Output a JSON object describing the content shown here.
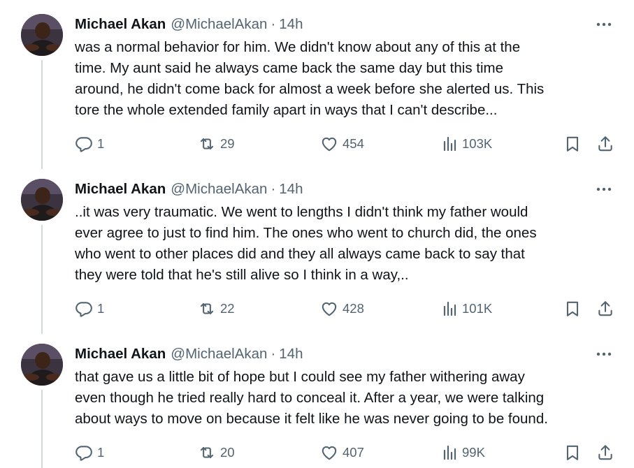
{
  "tweets": [
    {
      "author_name": "Michael Akan",
      "handle": "@MichaelAkan",
      "separator": "·",
      "time": "14h",
      "more_icon": "more-horizontal-icon",
      "text_lines": [
        "was a normal behavior for him. We didn't know about any of this at the",
        "time. My aunt said he always came back the same day but this time",
        "around, he didn't come back for almost a week before she alerted us. This",
        "tore the whole extended family apart in ways that I can't describe..."
      ],
      "replies": "1",
      "reposts": "29",
      "likes": "454",
      "views": "103K"
    },
    {
      "author_name": "Michael Akan",
      "handle": "@MichaelAkan",
      "separator": "·",
      "time": "14h",
      "more_icon": "more-horizontal-icon",
      "text_lines": [
        "..it was very traumatic. We went to lengths I didn't think my father would",
        "ever agree to just to find him. The ones who went to church did, the ones",
        "who went to other places did and they all always came back to say that",
        "they were told that he's still alive so I think in a way,.."
      ],
      "replies": "1",
      "reposts": "22",
      "likes": "428",
      "views": "101K"
    },
    {
      "author_name": "Michael Akan",
      "handle": "@MichaelAkan",
      "separator": "·",
      "time": "14h",
      "more_icon": "more-horizontal-icon",
      "text_lines": [
        "that gave us a little bit of hope but I could see my father withering away",
        "even though he tried really hard to conceal it.  After a year, we were talking",
        "about ways to move on because it felt like he was never going to be found."
      ],
      "replies": "1",
      "reposts": "20",
      "likes": "407",
      "views": "99K"
    }
  ],
  "icons": {
    "reply": "reply-icon",
    "repost": "repost-icon",
    "like": "like-icon",
    "views": "views-icon",
    "bookmark": "bookmark-icon",
    "share": "share-icon"
  },
  "colors": {
    "text": "#0f1419",
    "secondary": "#536471",
    "thread_line": "#cfd9de",
    "background": "#ffffff"
  }
}
